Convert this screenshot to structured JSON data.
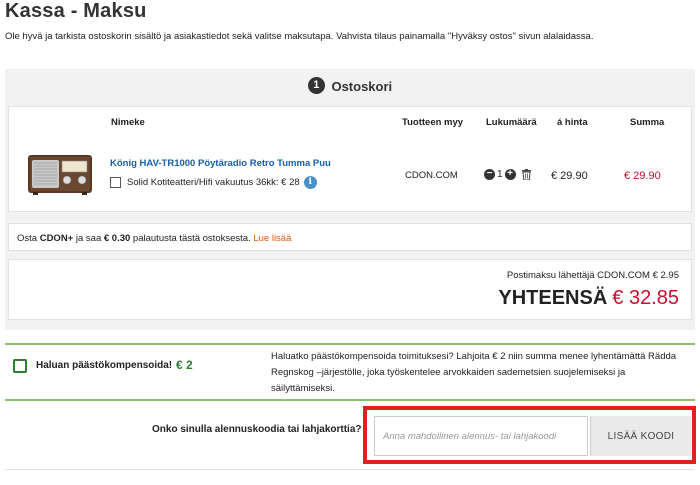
{
  "page": {
    "title": "Kassa - Maksu",
    "intro": "Ole hyvä ja tarkista ostoskorin sisältö ja asiakastiedot sekä valitse maksutapa. Vahvista tilaus painamalla \"Hyväksy ostos\" sivun alalaidassa."
  },
  "cart": {
    "step_number": "1",
    "header": "Ostoskori",
    "columns": {
      "name": "Nimeke",
      "seller": "Tuotteen myy",
      "quantity": "Lukumäärä",
      "unit_price": "á hinta",
      "sum": "Summa"
    },
    "items": [
      {
        "name": "König HAV-TR1000 Pöytäradio Retro Tumma Puu",
        "insurance_label": "Solid Kotiteatteri/Hifi vakuutus 36kk: € 28",
        "seller": "CDON.COM",
        "quantity": "1",
        "unit_price": "€ 29.90",
        "sum": "€ 29.90"
      }
    ],
    "cdonplus": {
      "prefix": "Osta ",
      "brand": "CDON+",
      "mid": " ja saa ",
      "amount": "€ 0.30",
      "suffix": " palautusta tästä ostoksesta. ",
      "link": "Lue lisää"
    },
    "shipping": "Postimaksu lähettäjä CDON.COM € 2.95",
    "total_label": "YHTEENSÄ",
    "total_amount": "€ 32.85"
  },
  "compensation": {
    "label": "Haluan päästökompensoida!",
    "price": "€ 2",
    "text": "Haluatko päästökompensoida toimituksesi? Lahjoita € 2 niin summa menee lyhentämättä Rädda Regnskog –järjestölle, joka työskentelee arvokkaiden sademetsien suojelemiseksi ja säilyttämiseksi."
  },
  "coupon": {
    "question": "Onko sinulla alennuskoodia tai lahjakorttia?",
    "placeholder": "Anna mahdollinen alennus- tai lahjakoodi",
    "button": "LISÄÄ KOODI"
  },
  "colors": {
    "price_red": "#c8102e",
    "link_blue": "#1a5ea8",
    "link_orange": "#e05a10",
    "green": "#2e7d32",
    "highlight_red": "#e02020"
  },
  "icons": {
    "step": "numbered-circle",
    "info": "info-icon",
    "minus": "minus-circle-icon",
    "plus": "plus-circle-icon",
    "delete": "trash-icon"
  }
}
